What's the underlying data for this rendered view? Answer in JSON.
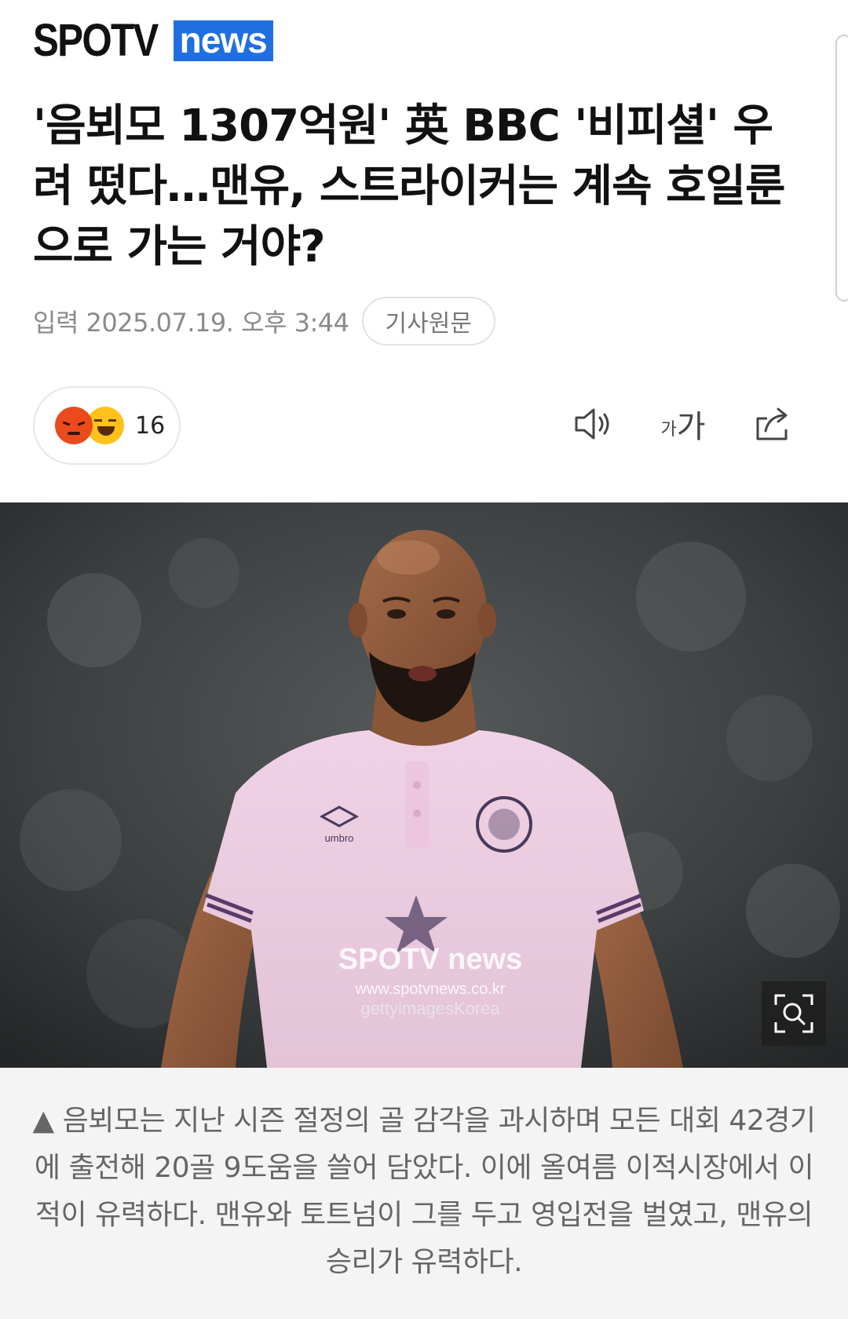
{
  "brand": {
    "name_part1": "SPOTV",
    "name_part2": "news"
  },
  "article": {
    "title": "'음뵈모 1307억원' 英 BBC '비피셜' 우려 떴다…맨유, 스트라이커는 계속 호일룬으로 가는 거야?",
    "date": "입력 2025.07.19. 오후 3:44",
    "original_link_label": "기사원문"
  },
  "reactions": {
    "count": "16",
    "emojis": [
      "angry-face-icon",
      "laughing-face-icon"
    ]
  },
  "toolbar": {
    "sound": "speaker-icon",
    "font_small": "가",
    "font_large": "가",
    "share": "share-icon"
  },
  "photo": {
    "watermark_line1": "SPOTV news",
    "watermark_line2": "www.spotvnews.co.kr",
    "watermark_line3": "gettyimagesKorea",
    "jersey_brand": "umbro",
    "zoom_icon": "zoom-icon"
  },
  "caption": {
    "text": "▲ 음뵈모는 지난 시즌 절정의 골 감각을 과시하며 모든 대회 42경기에 출전해 20골 9도움을 쓸어 담았다. 이에 올여름 이적시장에서 이적이 유력하다. 맨유와 토트넘이 그를 두고 영입전을 벌였고, 맨유의 승리가 유력하다."
  },
  "colors": {
    "brand_blue": "#1f6fe0",
    "meta_gray": "#8a8a8a",
    "caption_bg": "#f4f4f4"
  }
}
